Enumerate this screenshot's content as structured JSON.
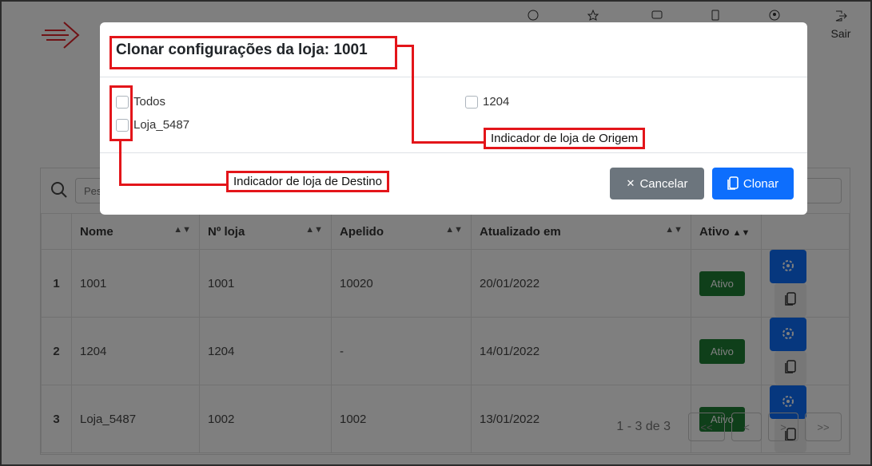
{
  "topbar": {
    "logo_icon": "arrow-logo-icon",
    "nav_icons": [
      "dashboard-icon",
      "star-icon",
      "chat-icon",
      "device-icon",
      "user-icon"
    ],
    "logout_label": "Sair",
    "logout_icon": "logout-icon"
  },
  "search": {
    "placeholder": "Pesquisar",
    "icon": "search-icon"
  },
  "table": {
    "headers": [
      "Nome",
      "Nº loja",
      "Apelido",
      "Atualizado em",
      "Ativo"
    ],
    "rows": [
      {
        "index": "1",
        "nome": "1001",
        "loja": "1001",
        "apelido": "10020",
        "atualizado": "20/01/2022",
        "ativo": "Ativo"
      },
      {
        "index": "2",
        "nome": "1204",
        "loja": "1204",
        "apelido": "-",
        "atualizado": "14/01/2022",
        "ativo": "Ativo"
      },
      {
        "index": "3",
        "nome": "Loja_5487",
        "loja": "1002",
        "apelido": "1002",
        "atualizado": "13/01/2022",
        "ativo": "Ativo"
      }
    ]
  },
  "pagination": {
    "summary": "1 - 3 de 3",
    "first": "<<",
    "prev": "<",
    "next": ">",
    "last": ">>"
  },
  "modal": {
    "title": "Clonar configurações da loja: 1001",
    "options": [
      {
        "label": "Todos",
        "checked": false
      },
      {
        "label": "Loja_5487",
        "checked": false
      },
      {
        "label": "1204",
        "checked": false
      }
    ],
    "cancel_label": "Cancelar",
    "clone_label": "Clonar"
  },
  "annotations": {
    "origin": "Indicador de loja de Origem",
    "destination": "Indicador de loja de Destino"
  },
  "colors": {
    "primary": "#0d6efd",
    "secondary": "#6c757d",
    "success": "#1e7e34",
    "annotation": "#e3151a"
  }
}
